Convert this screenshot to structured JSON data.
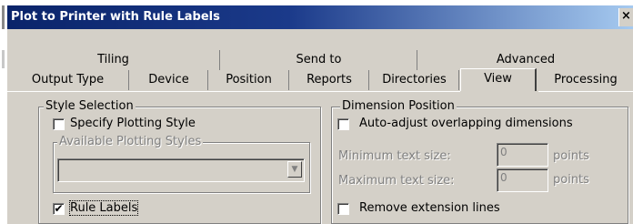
{
  "window": {
    "title": "Plot to Printer with Rule Labels",
    "close_icon": "×"
  },
  "tabs": {
    "row1": [
      "Tiling",
      "Send to",
      "Advanced"
    ],
    "row2": [
      "Output Type",
      "Device",
      "Position",
      "Reports",
      "Directories",
      "View",
      "Processing"
    ],
    "active": "View"
  },
  "style_selection": {
    "legend": "Style Selection",
    "specify_label": "Specify Plotting Style",
    "specify_checked": false,
    "available_legend": "Available Plotting Styles",
    "available_value": "",
    "rule_labels_label": "Rule Labels",
    "rule_labels_checked": true
  },
  "dimension_position": {
    "legend": "Dimension Position",
    "auto_adjust_label": "Auto-adjust overlapping dimensions",
    "auto_adjust_checked": false,
    "min_label": "Minimum text size:",
    "min_value": "0",
    "min_unit": "points",
    "max_label": "Maximum text size:",
    "max_value": "0",
    "max_unit": "points",
    "remove_ext_label": "Remove extension lines",
    "remove_ext_checked": false
  },
  "check_mark": "✔"
}
